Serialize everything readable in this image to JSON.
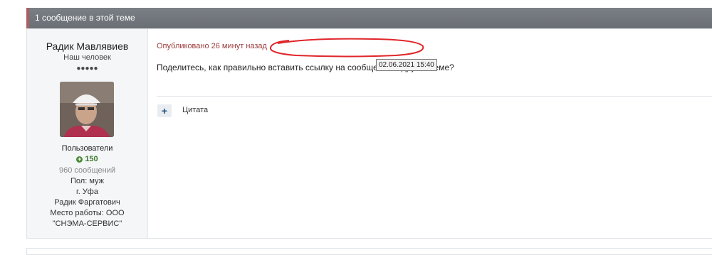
{
  "topic": {
    "header": "1 сообщение в этой теме"
  },
  "author": {
    "name": "Радик Мавлявиев",
    "title": "Наш человек",
    "pips": "●●●●●",
    "group": "Пользователи",
    "reputation": "150",
    "posts": "960 сообщений",
    "gender": "Пол: муж",
    "city": "г. Уфа",
    "first_name": "Радик Фаргатович",
    "work_line1": "Место работы: ООО",
    "work_line2": "\"СНЭМА-СЕРВИС\""
  },
  "post": {
    "posted": "Опубликовано 26 минут назад",
    "tooltip": "02.06.2021 15:40",
    "text": "Поделитесь, как правильно вставить ссылку на сообщение в другой теме?",
    "quote_label": "Цитата"
  },
  "colors": {
    "annotation_circle": "#e0262a",
    "reputation_green": "#4d8a3a",
    "posted_text": "#9a3b3b"
  },
  "icons": {
    "quote": "plus-icon",
    "reputation": "plus-circle-icon"
  }
}
